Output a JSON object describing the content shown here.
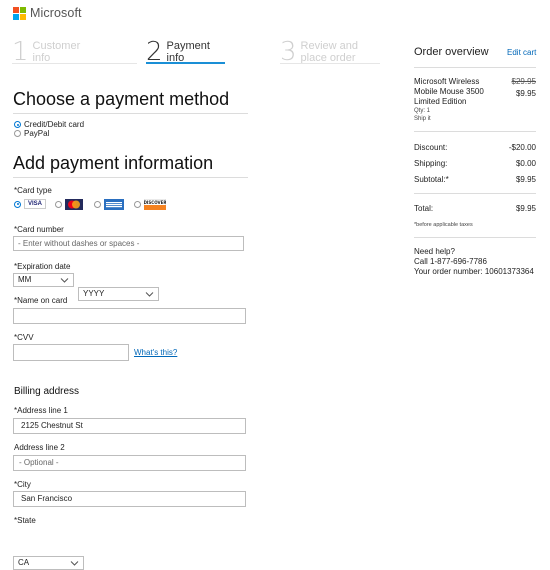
{
  "brand": {
    "name": "Microsoft",
    "colors": [
      "#f25022",
      "#7fba00",
      "#00a4ef",
      "#ffb900"
    ]
  },
  "steps": [
    {
      "num": "1",
      "line1": "Customer",
      "line2": "info",
      "state": "done"
    },
    {
      "num": "2",
      "line1": "Payment",
      "line2": "info",
      "state": "active"
    },
    {
      "num": "3",
      "line1": "Review and",
      "line2": "place order",
      "state": "upcoming"
    }
  ],
  "payment_method": {
    "title": "Choose a payment method",
    "options": [
      {
        "label": "Credit/Debit card",
        "selected": true
      },
      {
        "label": "PayPal",
        "selected": false
      }
    ]
  },
  "payment_info": {
    "title": "Add payment information",
    "card_type_label": "*Card type",
    "card_types": [
      {
        "name": "VISA",
        "selected": true
      },
      {
        "name": "MC",
        "selected": false
      },
      {
        "name": "AMEX",
        "selected": false
      },
      {
        "name": "DISCOVER",
        "selected": false
      }
    ],
    "card_number_label": "*Card number",
    "card_number_placeholder": "- Enter without dashes or spaces -",
    "expiration_label": "*Expiration date",
    "month_value": "MM",
    "year_value": "YYYY",
    "name_label": "*Name on card",
    "name_value": "",
    "cvv_label": "*CVV",
    "cvv_value": "",
    "whats_this": "What's this?"
  },
  "billing": {
    "title": "Billing address",
    "address1_label": "*Address line 1",
    "address1_value": "2125 Chestnut St",
    "address2_label": "Address line 2",
    "address2_placeholder": "- Optional -",
    "city_label": "*City",
    "city_value": "San Francisco",
    "state_label": "*State",
    "state_value": "CA"
  },
  "order": {
    "title": "Order overview",
    "edit_cart": "Edit cart",
    "item_line1": "Microsoft Wireless",
    "item_line2": "Mobile Mouse 3500",
    "item_line3": "Limited Edition",
    "qty": "Qty: 1",
    "ship": "Ship it",
    "old_price": "$29.95",
    "price": "$9.95",
    "discount_label": "Discount:",
    "discount_value": "-$20.00",
    "shipping_label": "Shipping:",
    "shipping_value": "$0.00",
    "subtotal_label": "Subtotal:*",
    "subtotal_value": "$9.95",
    "total_label": "Total:",
    "total_value": "$9.95",
    "tax_note": "*before applicable taxes",
    "help_title": "Need help?",
    "help_phone": "Call 1-877-696-7786",
    "order_number": "Your order number: 10601373364"
  }
}
